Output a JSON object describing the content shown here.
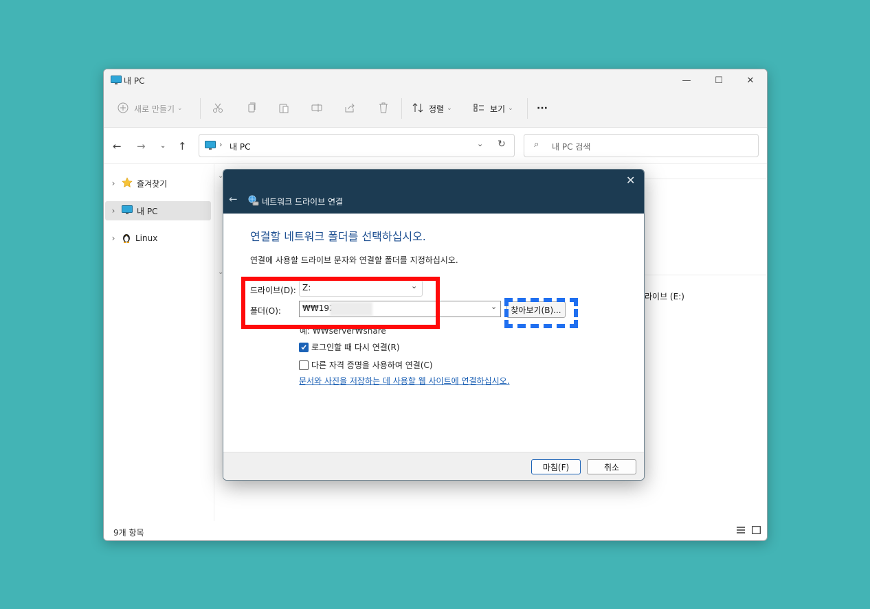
{
  "window": {
    "title": "내 PC",
    "minimize": "—",
    "maximize": "☐",
    "close": "✕"
  },
  "toolbar": {
    "new_label": "새로 만들기",
    "sort_label": "정렬",
    "view_label": "보기",
    "more_label": "···"
  },
  "address": {
    "path": "내 PC",
    "search_placeholder": "내 PC 검색"
  },
  "sidebar": {
    "items": [
      {
        "label": "즐겨찾기"
      },
      {
        "label": "내 PC"
      },
      {
        "label": "Linux"
      }
    ]
  },
  "content": {
    "partial_drive_label": "라이브 (E:)"
  },
  "status": {
    "item_count": "9개 항목"
  },
  "dialog": {
    "title": "네트워크 드라이브 연결",
    "heading": "연결할 네트워크 폴더를 선택하십시오.",
    "description": "연결에 사용할 드라이브 문자와 연결할 폴더를 지정하십시오.",
    "drive_label": "드라이브(D):",
    "drive_value": "Z:",
    "folder_label": "폴더(O):",
    "folder_value": "₩₩192",
    "browse_label": "찾아보기(B)...",
    "example": "예: ₩₩server₩share",
    "reconnect_label": "로그인할 때 다시 연결(R)",
    "reconnect_checked": true,
    "credentials_label": "다른 자격 증명을 사용하여 연결(C)",
    "credentials_checked": false,
    "link_text": "문서와 사진을 저장하는 데 사용할 웹 사이트에 연결하십시오.",
    "finish_label": "마침(F)",
    "cancel_label": "취소"
  },
  "colors": {
    "background": "#43b4b5",
    "dialog_header": "#1c3b52",
    "highlight_red": "#ff0a0a",
    "highlight_blue": "#1f6ff0",
    "link": "#1a5fb4"
  }
}
